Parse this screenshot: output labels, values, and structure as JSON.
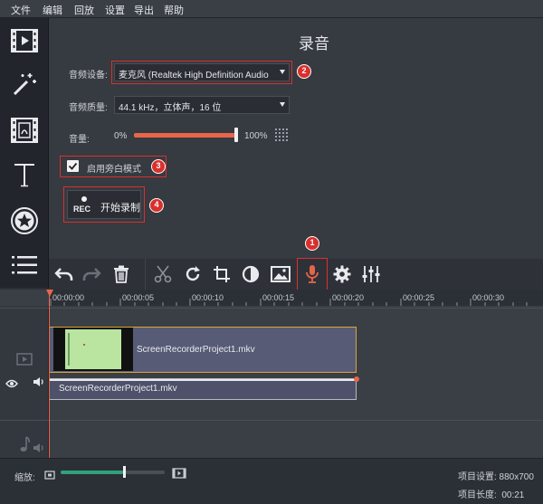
{
  "menu": [
    "文件",
    "编辑",
    "回放",
    "设置",
    "导出",
    "帮助"
  ],
  "sidebar": {
    "items": [
      "video-clips-icon",
      "magic-wand-icon",
      "filmstrip-icon",
      "text-icon",
      "sticker-star-icon",
      "list-menu-icon"
    ]
  },
  "panel": {
    "title": "录音",
    "audio_device_label": "音频设备:",
    "audio_device_value": "麦克风 (Realtek High Definition Audio",
    "audio_quality_label": "音频质量:",
    "audio_quality_value": "44.1 kHz，立体声，16 位",
    "volume_label": "音量:",
    "volume_min": "0%",
    "volume_max": "100%",
    "volume_level": 1.0,
    "voiceover_checkbox_label": "启用旁白模式",
    "voiceover_checked": true,
    "rec_icon_text": "REC",
    "start_record_label": "开始录制",
    "badges": [
      "1",
      "2",
      "3",
      "4"
    ]
  },
  "toolbar": {
    "tools": [
      "undo-icon",
      "redo-icon",
      "delete-icon",
      "scissors-icon",
      "rotate-icon",
      "crop-icon",
      "color-adjust-icon",
      "image-icon",
      "microphone-icon",
      "settings-gear-icon",
      "equalizer-icon"
    ],
    "active": "microphone-icon"
  },
  "timeline": {
    "ticks": [
      "00:00:00",
      "00:00:05",
      "00:00:10",
      "00:00:15",
      "00:00:20",
      "00:00:25",
      "00:00:30"
    ],
    "video_clip_name": "ScreenRecorderProject1.mkv",
    "audio_clip_name": "ScreenRecorderProject1.mkv"
  },
  "bottom": {
    "zoom_label": "缩放:",
    "zoom_level": 0.6,
    "project_settings": "项目设置: 880x700",
    "project_length": "项目长度:  00:21"
  },
  "colors": {
    "accent": "#e8654a",
    "highlight_box": "#d9302c",
    "clip_border": "#d9a53a"
  }
}
